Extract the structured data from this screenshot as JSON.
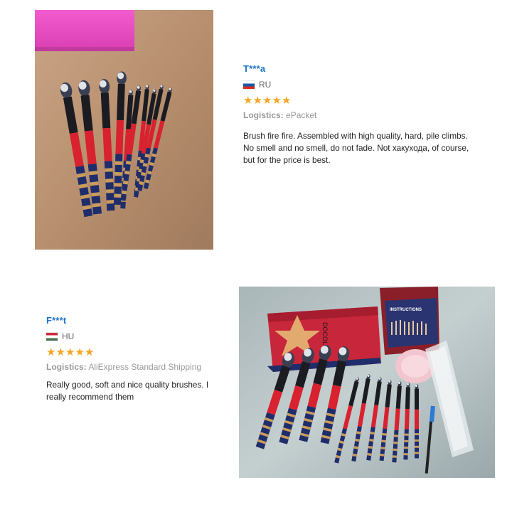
{
  "reviews": [
    {
      "username": "T***a",
      "country": "RU",
      "rating": 5,
      "logistics_label": "Logistics:",
      "logistics_value": "ePacket",
      "text": "Brush fire fire. Assembled with high quality, hard, pile climbs. No smell and no smell, do not fade. Not хакухода, of course, but for the price is best.",
      "photo": "photo of makeup brush set on carpet"
    },
    {
      "username": "F***t",
      "country": "HU",
      "rating": 5,
      "logistics_label": "Logistics:",
      "logistics_value": "AliExpress Standard Shipping",
      "text": "Really good, soft and nice quality brushes. I really recommend them",
      "photo": "photo of makeup brush set with box and instructions"
    }
  ],
  "photo2_labels": {
    "box_title": "INSTRUCTIONS",
    "brand": "DOCOLOR"
  },
  "colors": {
    "username": "#1e73c8",
    "star": "#f5a623",
    "brush_red": "#d8222f",
    "brush_navy": "#1f2d6b",
    "gold": "#c99b5c"
  },
  "icons": {
    "flag_ru": "russia-flag-icon",
    "flag_hu": "hungary-flag-icon",
    "star": "star-icon"
  }
}
